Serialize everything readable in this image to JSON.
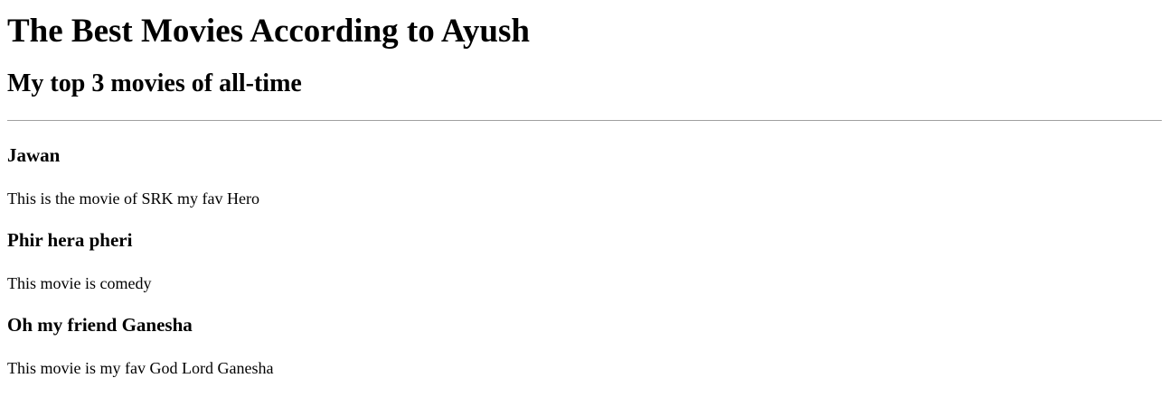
{
  "page": {
    "title": "The Best Movies According to Ayush",
    "subtitle": "My top 3 movies of all-time"
  },
  "movies": [
    {
      "title": "Jawan",
      "description": "This is the movie of SRK my fav Hero"
    },
    {
      "title": "Phir hera pheri",
      "description": "This movie is comedy"
    },
    {
      "title": "Oh my friend Ganesha",
      "description": "This movie is my fav God Lord Ganesha"
    }
  ]
}
